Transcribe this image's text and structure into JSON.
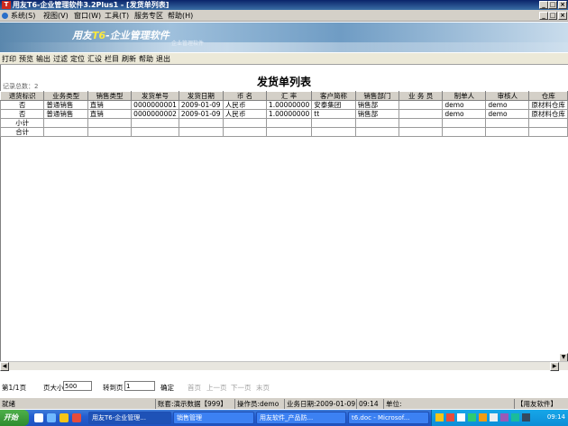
{
  "window": {
    "title": "用友T6-企业管理软件3.2Plus1  - [发货单列表]",
    "icon_label": "T"
  },
  "menubar": {
    "items": [
      "系统(S)",
      "视图(V)",
      "窗口(W)",
      "工具(T)",
      "服务专区",
      "帮助(H)"
    ]
  },
  "banner": {
    "brand": "用友",
    "brand_t6": "T6",
    "product": "-企业管理软件",
    "sub": "企业管理软件"
  },
  "toolbar": {
    "items": [
      "打印",
      "预览",
      "输出",
      "过滤",
      "定位",
      "汇设",
      "栏目",
      "刷新",
      "帮助",
      "退出"
    ]
  },
  "report": {
    "title": "发货单列表",
    "record_count": "记录总数：2"
  },
  "grid": {
    "columns": [
      "退货标识",
      "业务类型",
      "销售类型",
      "发货单号",
      "发货日期",
      "币 名",
      "汇 率",
      "客户简称",
      "销售部门",
      "业 务 员",
      "制单人",
      "审核人",
      "仓库"
    ],
    "rows": [
      [
        "否",
        "普通销售",
        "直销",
        "0000000001",
        "2009-01-09",
        "人民币",
        "1.00000000",
        "安泰集团",
        "销售部",
        "",
        "demo",
        "demo",
        "原材料仓库"
      ],
      [
        "否",
        "普通销售",
        "直销",
        "0000000002",
        "2009-01-09",
        "人民币",
        "1.00000000",
        "tt",
        "销售部",
        "",
        "demo",
        "demo",
        "原材料仓库"
      ],
      [
        "小计",
        "",
        "",
        "",
        "",
        "",
        "",
        "",
        "",
        "",
        "",
        "",
        ""
      ],
      [
        "合计",
        "",
        "",
        "",
        "",
        "",
        "",
        "",
        "",
        "",
        "",
        "",
        ""
      ]
    ]
  },
  "pager": {
    "page_info": "第1/1页",
    "page_size_label": "页大小",
    "page_size_value": "500",
    "goto_label": "转到页",
    "goto_value": "1",
    "confirm": "确定",
    "first": "首页",
    "prev": "上一页",
    "next": "下一页",
    "last": "末页"
  },
  "status": {
    "ready": "就绪",
    "account": "账套:演示数据【999】",
    "operator": "操作员:demo",
    "date": "业务日期:2009-01-09",
    "time": "09:14",
    "unit": "单位:",
    "vendor": "【用友软件】"
  },
  "taskbar": {
    "start": "开始",
    "tasks": [
      "用友T6-企业管理...",
      "销售管理",
      "用友软件_产品防...",
      "t6.doc - Microsof..."
    ],
    "clock": "09:14"
  }
}
